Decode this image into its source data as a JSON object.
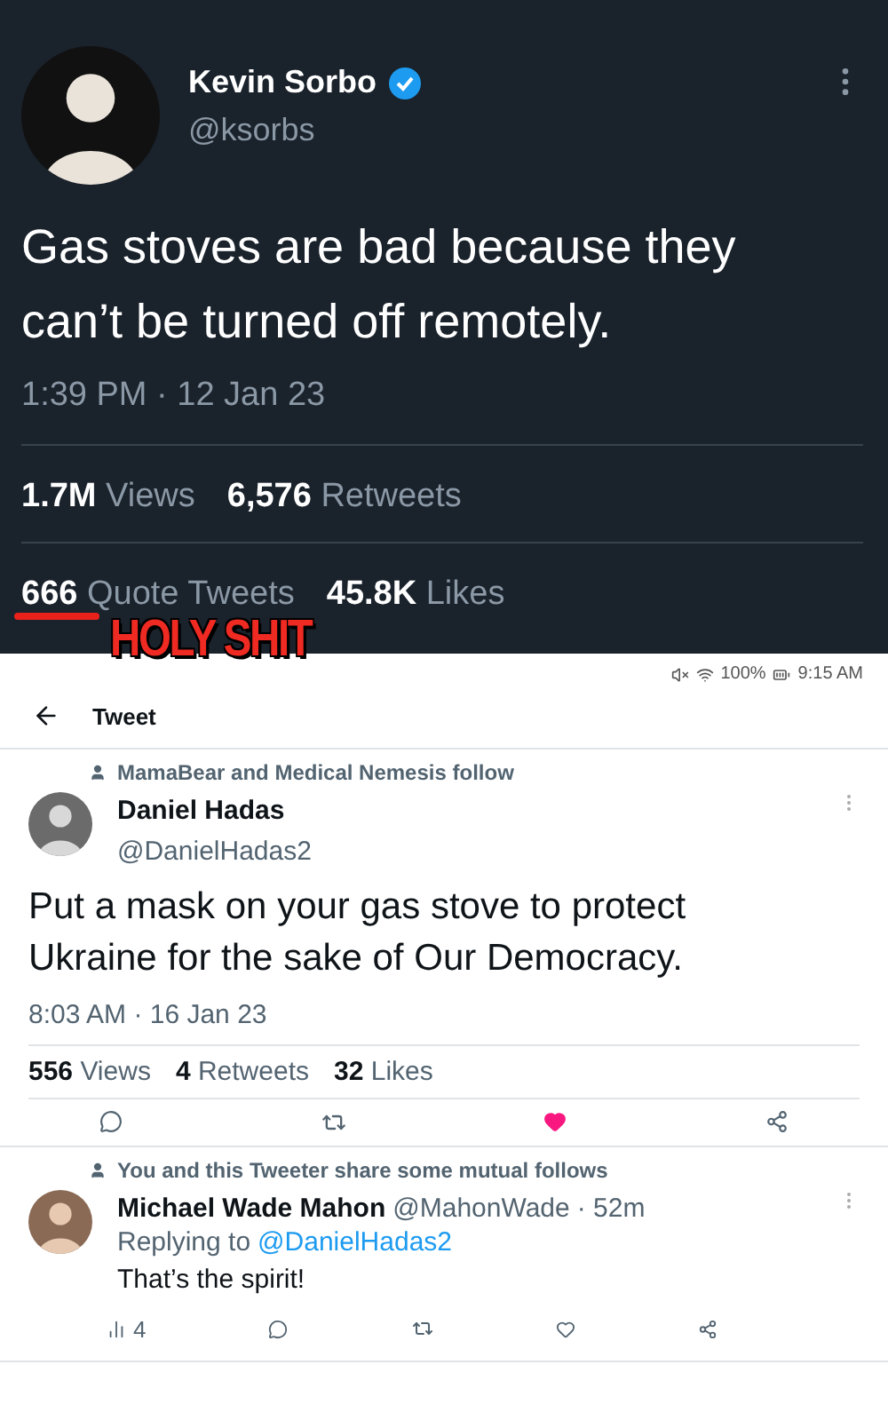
{
  "original_tweet": {
    "name": "Kevin Sorbo",
    "verified": true,
    "handle": "@ksorbs",
    "text": "Gas stoves are bad because they can’t be turned off remotely.",
    "time": "1:39 PM · 12 Jan 23",
    "stat_rows": [
      [
        "**1.7M** Views",
        "**6,576** Retweets"
      ],
      [
        "**666** Quote Tweets",
        "**45.8K** Likes"
      ]
    ]
  },
  "annotation": {
    "text": "HOLY SHIT"
  },
  "status_bar": {
    "battery": "100%",
    "time": "9:15 AM"
  },
  "header": {
    "title": "Tweet"
  },
  "tweet": {
    "social_context": "MamaBear and Medical Nemesis follow",
    "name": "Daniel Hadas",
    "handle": "@DanielHadas2",
    "text": "Put a mask on your gas stove to protect Ukraine for the sake of Our Democracy.",
    "time": "8:03 AM · 16 Jan 23",
    "stats": [
      "**556** Views",
      "**4** Retweets",
      "**32** Likes"
    ],
    "liked": true
  },
  "reply": {
    "social_context": "You and this Tweeter share some mutual follows",
    "name": "Michael Wade Mahon",
    "handle": "@MahonWade",
    "age": "· 52m",
    "replying_prefix": "Replying to",
    "replying_to": "@DanielHadas2",
    "text": "That’s the spirit!",
    "views": "4",
    "liked": false
  }
}
